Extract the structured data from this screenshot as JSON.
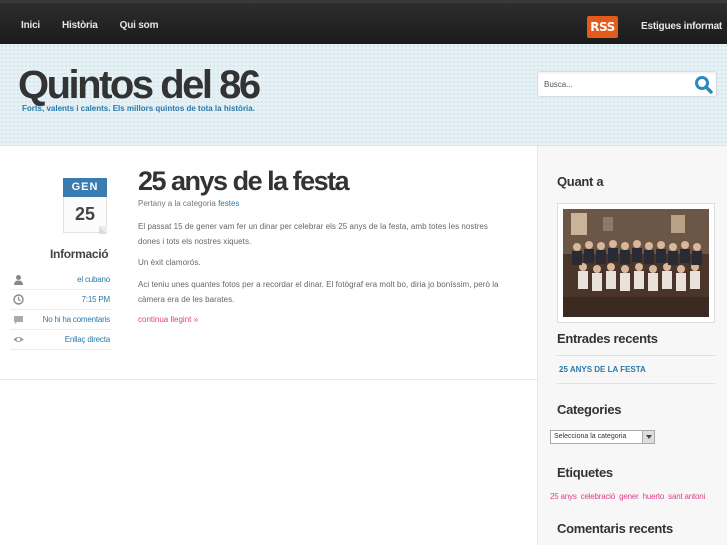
{
  "nav": {
    "items": [
      "Inici",
      "Història",
      "Qui som"
    ],
    "rss_label": "RSS",
    "stay_informed": "Estigues informat"
  },
  "header": {
    "title": "Quintos del 86",
    "description": "Forts, valents i calents. Els millors quintos de tota la història.",
    "search_placeholder": "Busca..."
  },
  "post": {
    "date_month": "GEN",
    "date_day": "25",
    "info_title": "Informació",
    "info": {
      "author": "el cubano",
      "time": "7:15 PM",
      "comments": "No hi ha comentaris",
      "permalink": "Enllaç directa"
    },
    "title": "25 anys de la festa",
    "category_prefix": "Pertany a la categoria",
    "category": "festes",
    "paragraphs": [
      "El passat 15 de gener vam fer un dinar per celebrar els 25 anys de la festa, amb totes les nostres dones i tots els nostres xiquets.",
      "Un èxit clamorós.",
      "Aci teniu unes quantes fotos per a recordar el dinar. El fotògraf era molt bo, diria jo boníssim, però la càmera era de les barates."
    ],
    "read_more": "continua llegint »"
  },
  "sidebar": {
    "about_title": "Quant a",
    "recent_title": "Entrades recents",
    "recent_items": [
      "25 ANYS DE LA FESTA"
    ],
    "categories_title": "Categories",
    "categories_select": "Selecciona la categoria",
    "tags_title": "Etiquetes",
    "tags": [
      "25 anys",
      "celebració",
      "gener",
      "huerto",
      "sant antoni"
    ],
    "comments_title": "Comentaris recents"
  },
  "colors": {
    "accent_blue": "#2a7aa8",
    "link_pink": "#e03f8d",
    "rss_orange": "#e25a1c",
    "nav_bg": "#1f1f1f"
  }
}
